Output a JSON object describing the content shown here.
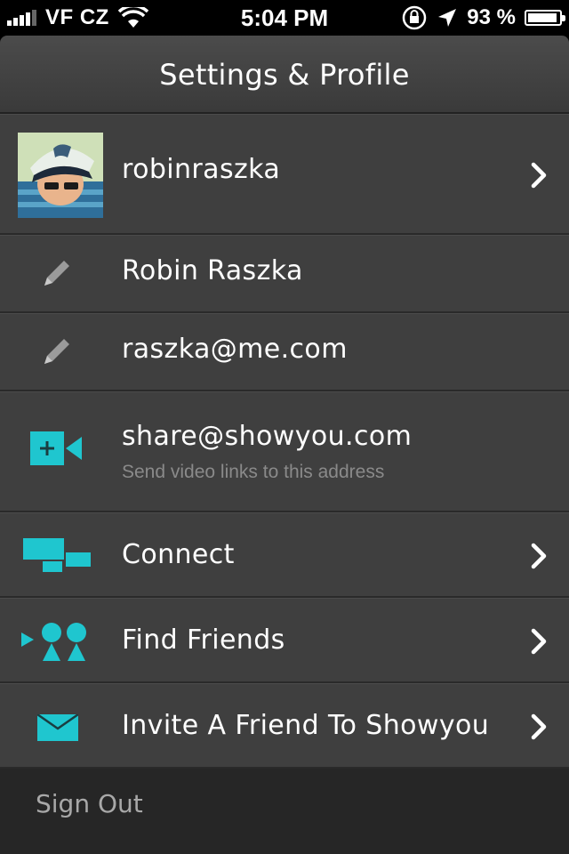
{
  "status_bar": {
    "carrier": "VF CZ",
    "time": "5:04 PM",
    "battery_percent_text": "93 %",
    "battery_level": 0.93,
    "icons": [
      "signal-icon",
      "wifi-icon",
      "rotation-lock-icon",
      "location-icon",
      "battery-icon"
    ]
  },
  "nav": {
    "title": "Settings & Profile"
  },
  "rows": {
    "profile": {
      "label": "robinraszka"
    },
    "name": {
      "label": "Robin Raszka"
    },
    "email": {
      "label": "raszka@me.com"
    },
    "share": {
      "label": "share@showyou.com",
      "sublabel": "Send video links to this address"
    },
    "connect": {
      "label": "Connect"
    },
    "find_friends": {
      "label": "Find Friends"
    },
    "invite": {
      "label": "Invite A Friend To Showyou"
    }
  },
  "footer": {
    "sign_out": "Sign Out"
  },
  "colors": {
    "accent": "#1fc6cf",
    "row_bg": "#3f3f3f",
    "footer_bg": "#262626"
  }
}
